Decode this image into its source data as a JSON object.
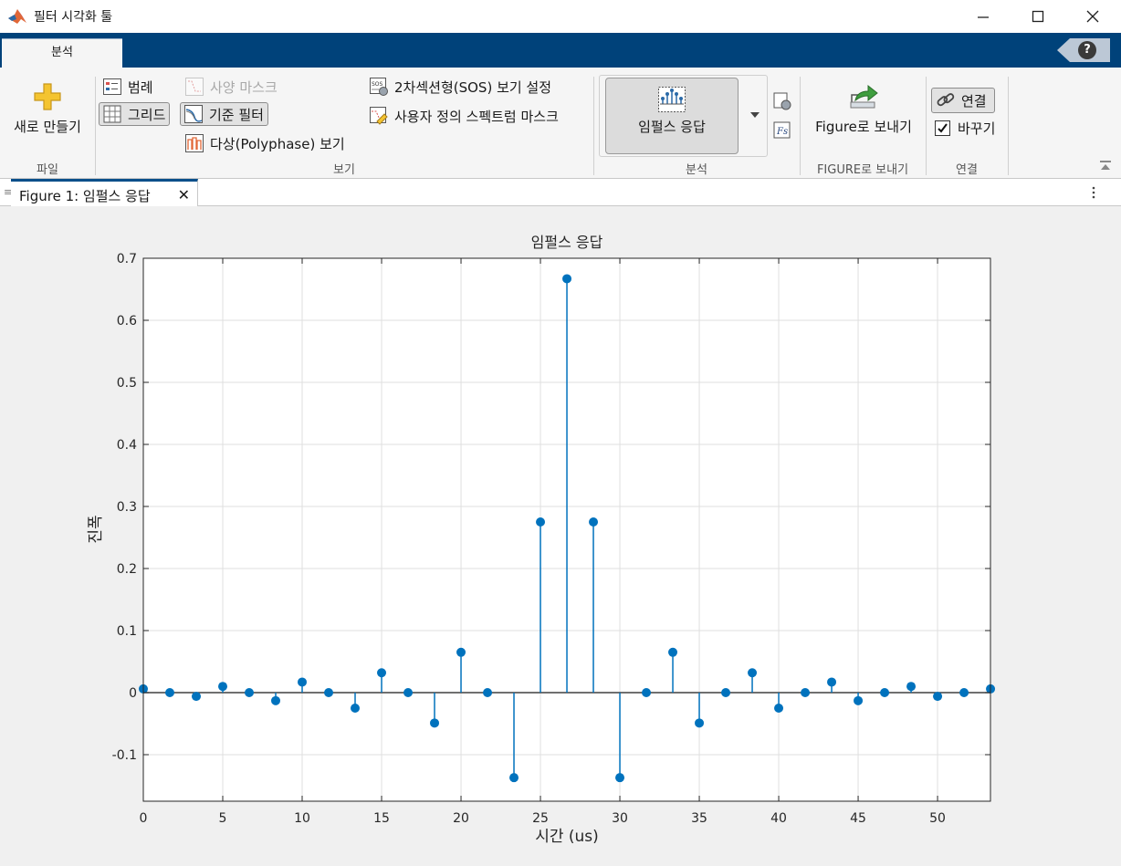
{
  "window": {
    "title": "필터 시각화 툴"
  },
  "toolstrip": {
    "tab_label": "분석",
    "help_label": "?"
  },
  "ribbon": {
    "file": {
      "section_label": "파일",
      "new_label": "새로 만들기"
    },
    "view": {
      "section_label": "보기",
      "legend_label": "범례",
      "grid_label": "그리드",
      "spec_mask_label": "사양 마스크",
      "ref_filter_label": "기준 필터",
      "polyphase_label": "다상(Polyphase) 보기",
      "sos_label": "2차섹션형(SOS) 보기 설정",
      "user_mask_label": "사용자 정의 스펙트럼 마스크"
    },
    "analysis": {
      "section_label": "분석",
      "impulse_label": "임펄스 응답"
    },
    "export": {
      "section_label": "FIGURE로 보내기",
      "export_label": "Figure로 보내기"
    },
    "link": {
      "section_label": "연결",
      "link_label": "연결",
      "replace_label": "바꾸기",
      "replace_checked": true
    }
  },
  "document": {
    "tab_label": "Figure 1: 임펄스 응답"
  },
  "chart_data": {
    "type": "stem",
    "title": "임펄스 응답",
    "xlabel": "시간 (us)",
    "ylabel": "진폭",
    "xlim": [
      0,
      53.33
    ],
    "ylim": [
      -0.175,
      0.7
    ],
    "xticks": [
      "0",
      "5",
      "10",
      "15",
      "20",
      "25",
      "30",
      "35",
      "40",
      "45",
      "50"
    ],
    "yticks": [
      "-0.1",
      "0",
      "0.1",
      "0.2",
      "0.3",
      "0.4",
      "0.5",
      "0.6",
      "0.7"
    ],
    "grid": true,
    "color": "#0072bd",
    "x": [
      0,
      1.667,
      3.333,
      5,
      6.667,
      8.333,
      10,
      11.667,
      13.333,
      15,
      16.667,
      18.333,
      20,
      21.667,
      23.333,
      25,
      26.667,
      28.333,
      30,
      31.667,
      33.333,
      35,
      36.667,
      38.333,
      40,
      41.667,
      43.333,
      45,
      46.667,
      48.333,
      50,
      51.667,
      53.333
    ],
    "values": [
      0.006,
      0,
      -0.006,
      0.01,
      0,
      -0.013,
      0.017,
      0,
      -0.025,
      0.032,
      0,
      -0.049,
      0.065,
      0,
      -0.137,
      0.275,
      0.667,
      0.275,
      -0.137,
      0,
      0.065,
      -0.049,
      0,
      0.032,
      -0.025,
      0,
      0.017,
      -0.013,
      0,
      0.01,
      -0.006,
      0,
      0.006
    ]
  }
}
